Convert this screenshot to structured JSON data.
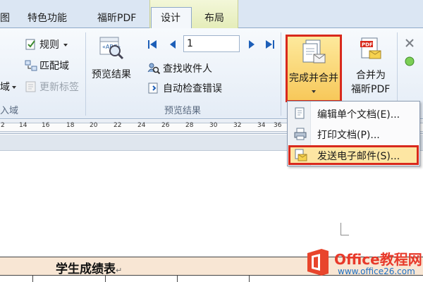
{
  "tabs": {
    "partial": "图",
    "special": "特色功能",
    "fuxin_pdf": "福昕PDF",
    "design": "设计",
    "layout": "布局"
  },
  "ribbon": {
    "rules": "规则",
    "match_fields": "匹配域",
    "domain_partial": "域",
    "update_labels": "更新标签",
    "insert_fields_group": "入域",
    "preview_results_button": "预览结果",
    "find_recipient": "查找收件人",
    "auto_check_errors": "自动检查错误",
    "preview_group": "预览结果",
    "record_number": "1",
    "finish_and_merge": "完成并合并",
    "merge_to_pdf_line1": "合并为",
    "merge_to_pdf_line2": "福昕PDF"
  },
  "ruler": {
    "ticks": [
      "2",
      "14",
      "16",
      "18",
      "20",
      "22",
      "24",
      "26",
      "28",
      "30",
      "32",
      "34",
      "36",
      "38"
    ]
  },
  "dropdown": {
    "edit_single": "编辑单个文档(E)...",
    "print_docs": "打印文档(P)...",
    "send_email": "发送电子邮件(S)..."
  },
  "document": {
    "table_title": "学生成绩表",
    "paragraph_mark": "↵"
  },
  "watermark": {
    "title": "Office教程网",
    "url": "www.office26.com"
  },
  "colors": {
    "highlight_border": "#d8291c",
    "accent": "#f7c85a"
  }
}
